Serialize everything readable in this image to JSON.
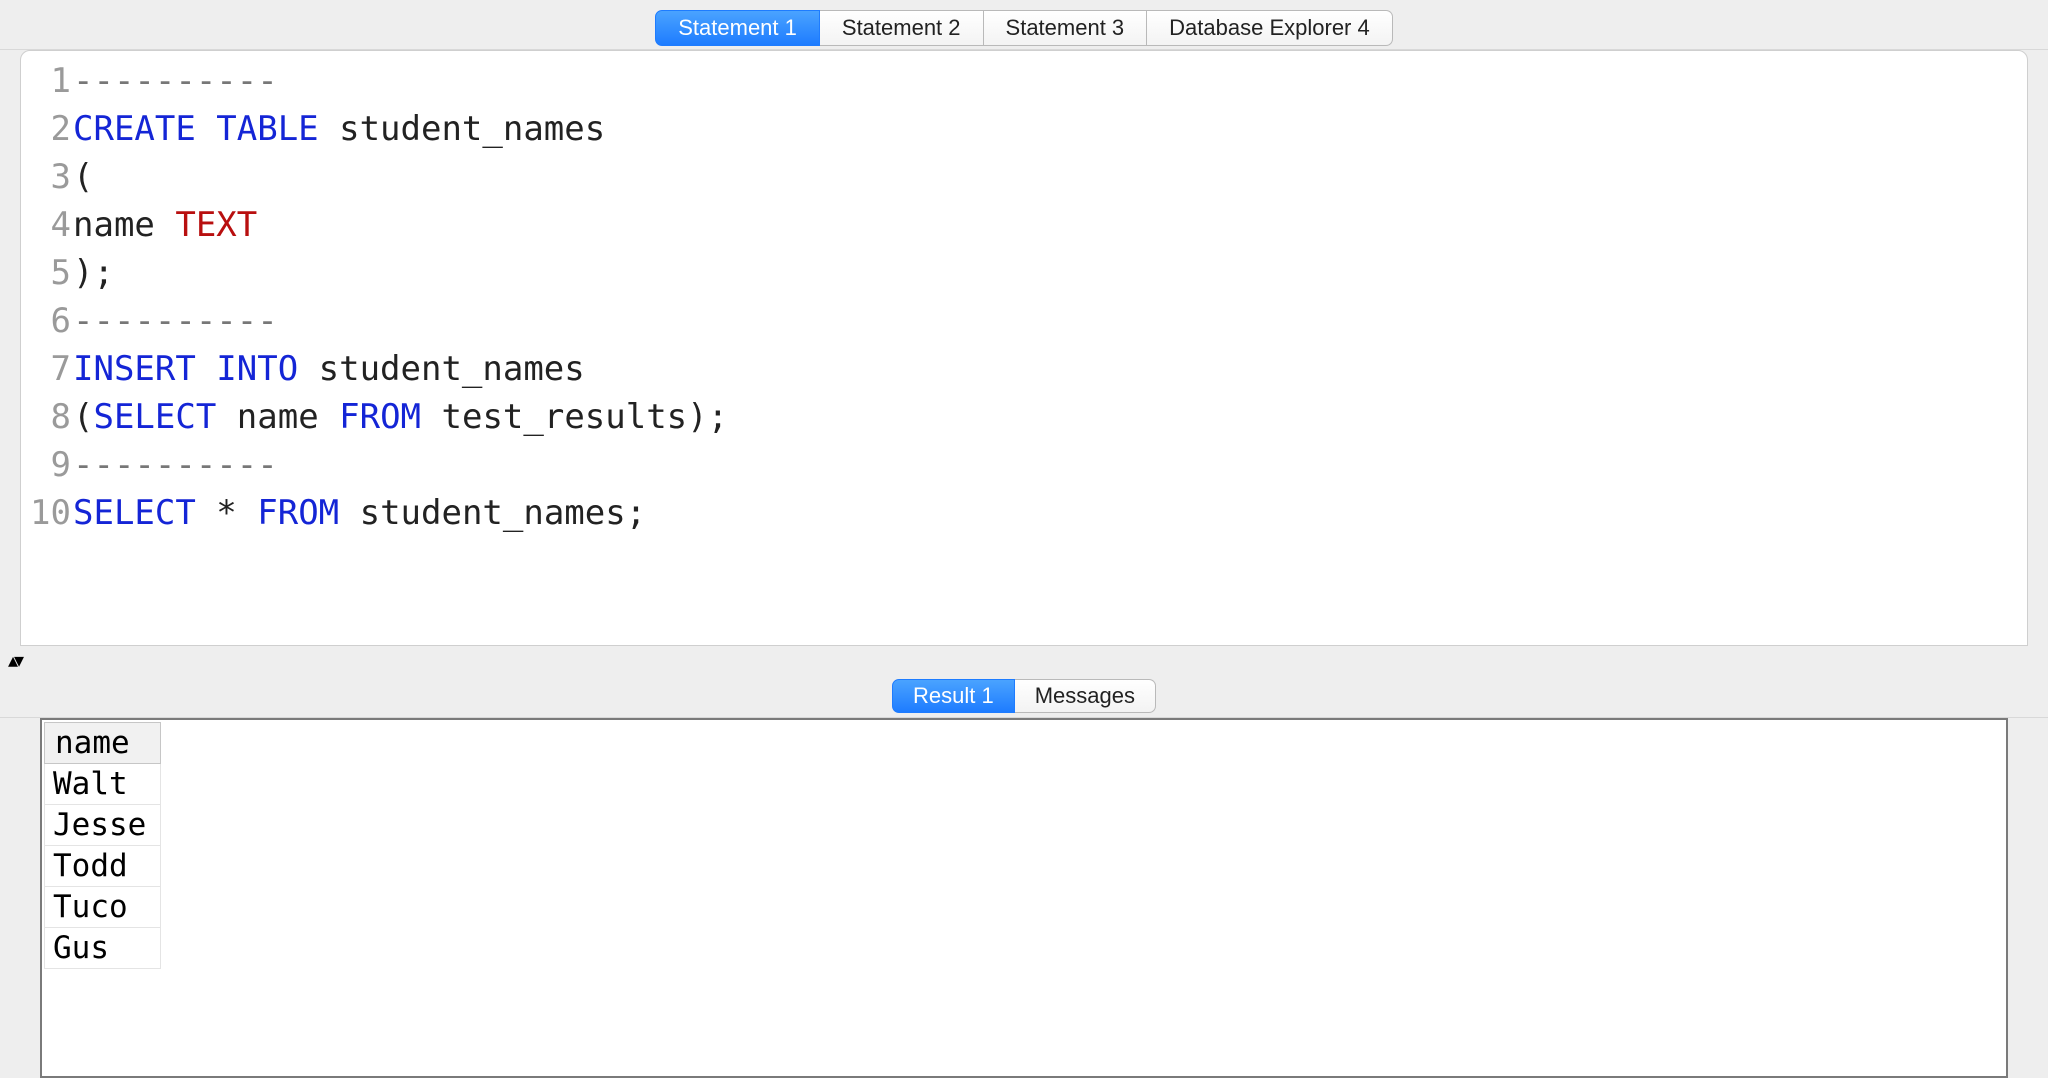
{
  "top_tabs": {
    "active_index": 0,
    "items": [
      {
        "label": "Statement 1"
      },
      {
        "label": "Statement 2"
      },
      {
        "label": "Statement 3"
      },
      {
        "label": "Database Explorer 4"
      }
    ]
  },
  "editor": {
    "lines": [
      {
        "n": "1",
        "tokens": [
          {
            "t": "----------",
            "c": "sep"
          }
        ]
      },
      {
        "n": "2",
        "tokens": [
          {
            "t": "CREATE TABLE",
            "c": "kw"
          },
          {
            "t": " student_names",
            "c": "code"
          }
        ]
      },
      {
        "n": "3",
        "tokens": [
          {
            "t": "(",
            "c": "code"
          }
        ]
      },
      {
        "n": "4",
        "tokens": [
          {
            "t": "name ",
            "c": "code"
          },
          {
            "t": "TEXT",
            "c": "type"
          }
        ]
      },
      {
        "n": "5",
        "tokens": [
          {
            "t": ");",
            "c": "code"
          }
        ]
      },
      {
        "n": "6",
        "tokens": [
          {
            "t": "----------",
            "c": "sep"
          }
        ]
      },
      {
        "n": "7",
        "tokens": [
          {
            "t": "INSERT INTO",
            "c": "kw"
          },
          {
            "t": " student_names",
            "c": "code"
          }
        ]
      },
      {
        "n": "8",
        "tokens": [
          {
            "t": "(",
            "c": "code"
          },
          {
            "t": "SELECT",
            "c": "kw"
          },
          {
            "t": " name ",
            "c": "code"
          },
          {
            "t": "FROM",
            "c": "kw"
          },
          {
            "t": " test_results);",
            "c": "code"
          }
        ]
      },
      {
        "n": "9",
        "tokens": [
          {
            "t": "----------",
            "c": "sep"
          }
        ]
      },
      {
        "n": "10",
        "tokens": [
          {
            "t": "SELECT",
            "c": "kw"
          },
          {
            "t": " * ",
            "c": "code"
          },
          {
            "t": "FROM",
            "c": "kw"
          },
          {
            "t": " student_names;",
            "c": "code"
          }
        ]
      }
    ]
  },
  "split_handle": "▴▾",
  "result_tabs": {
    "active_index": 0,
    "items": [
      {
        "label": "Result 1"
      },
      {
        "label": "Messages"
      }
    ]
  },
  "result": {
    "columns": [
      "name"
    ],
    "rows": [
      [
        "Walt"
      ],
      [
        "Jesse"
      ],
      [
        "Todd"
      ],
      [
        "Tuco"
      ],
      [
        "Gus"
      ]
    ]
  }
}
